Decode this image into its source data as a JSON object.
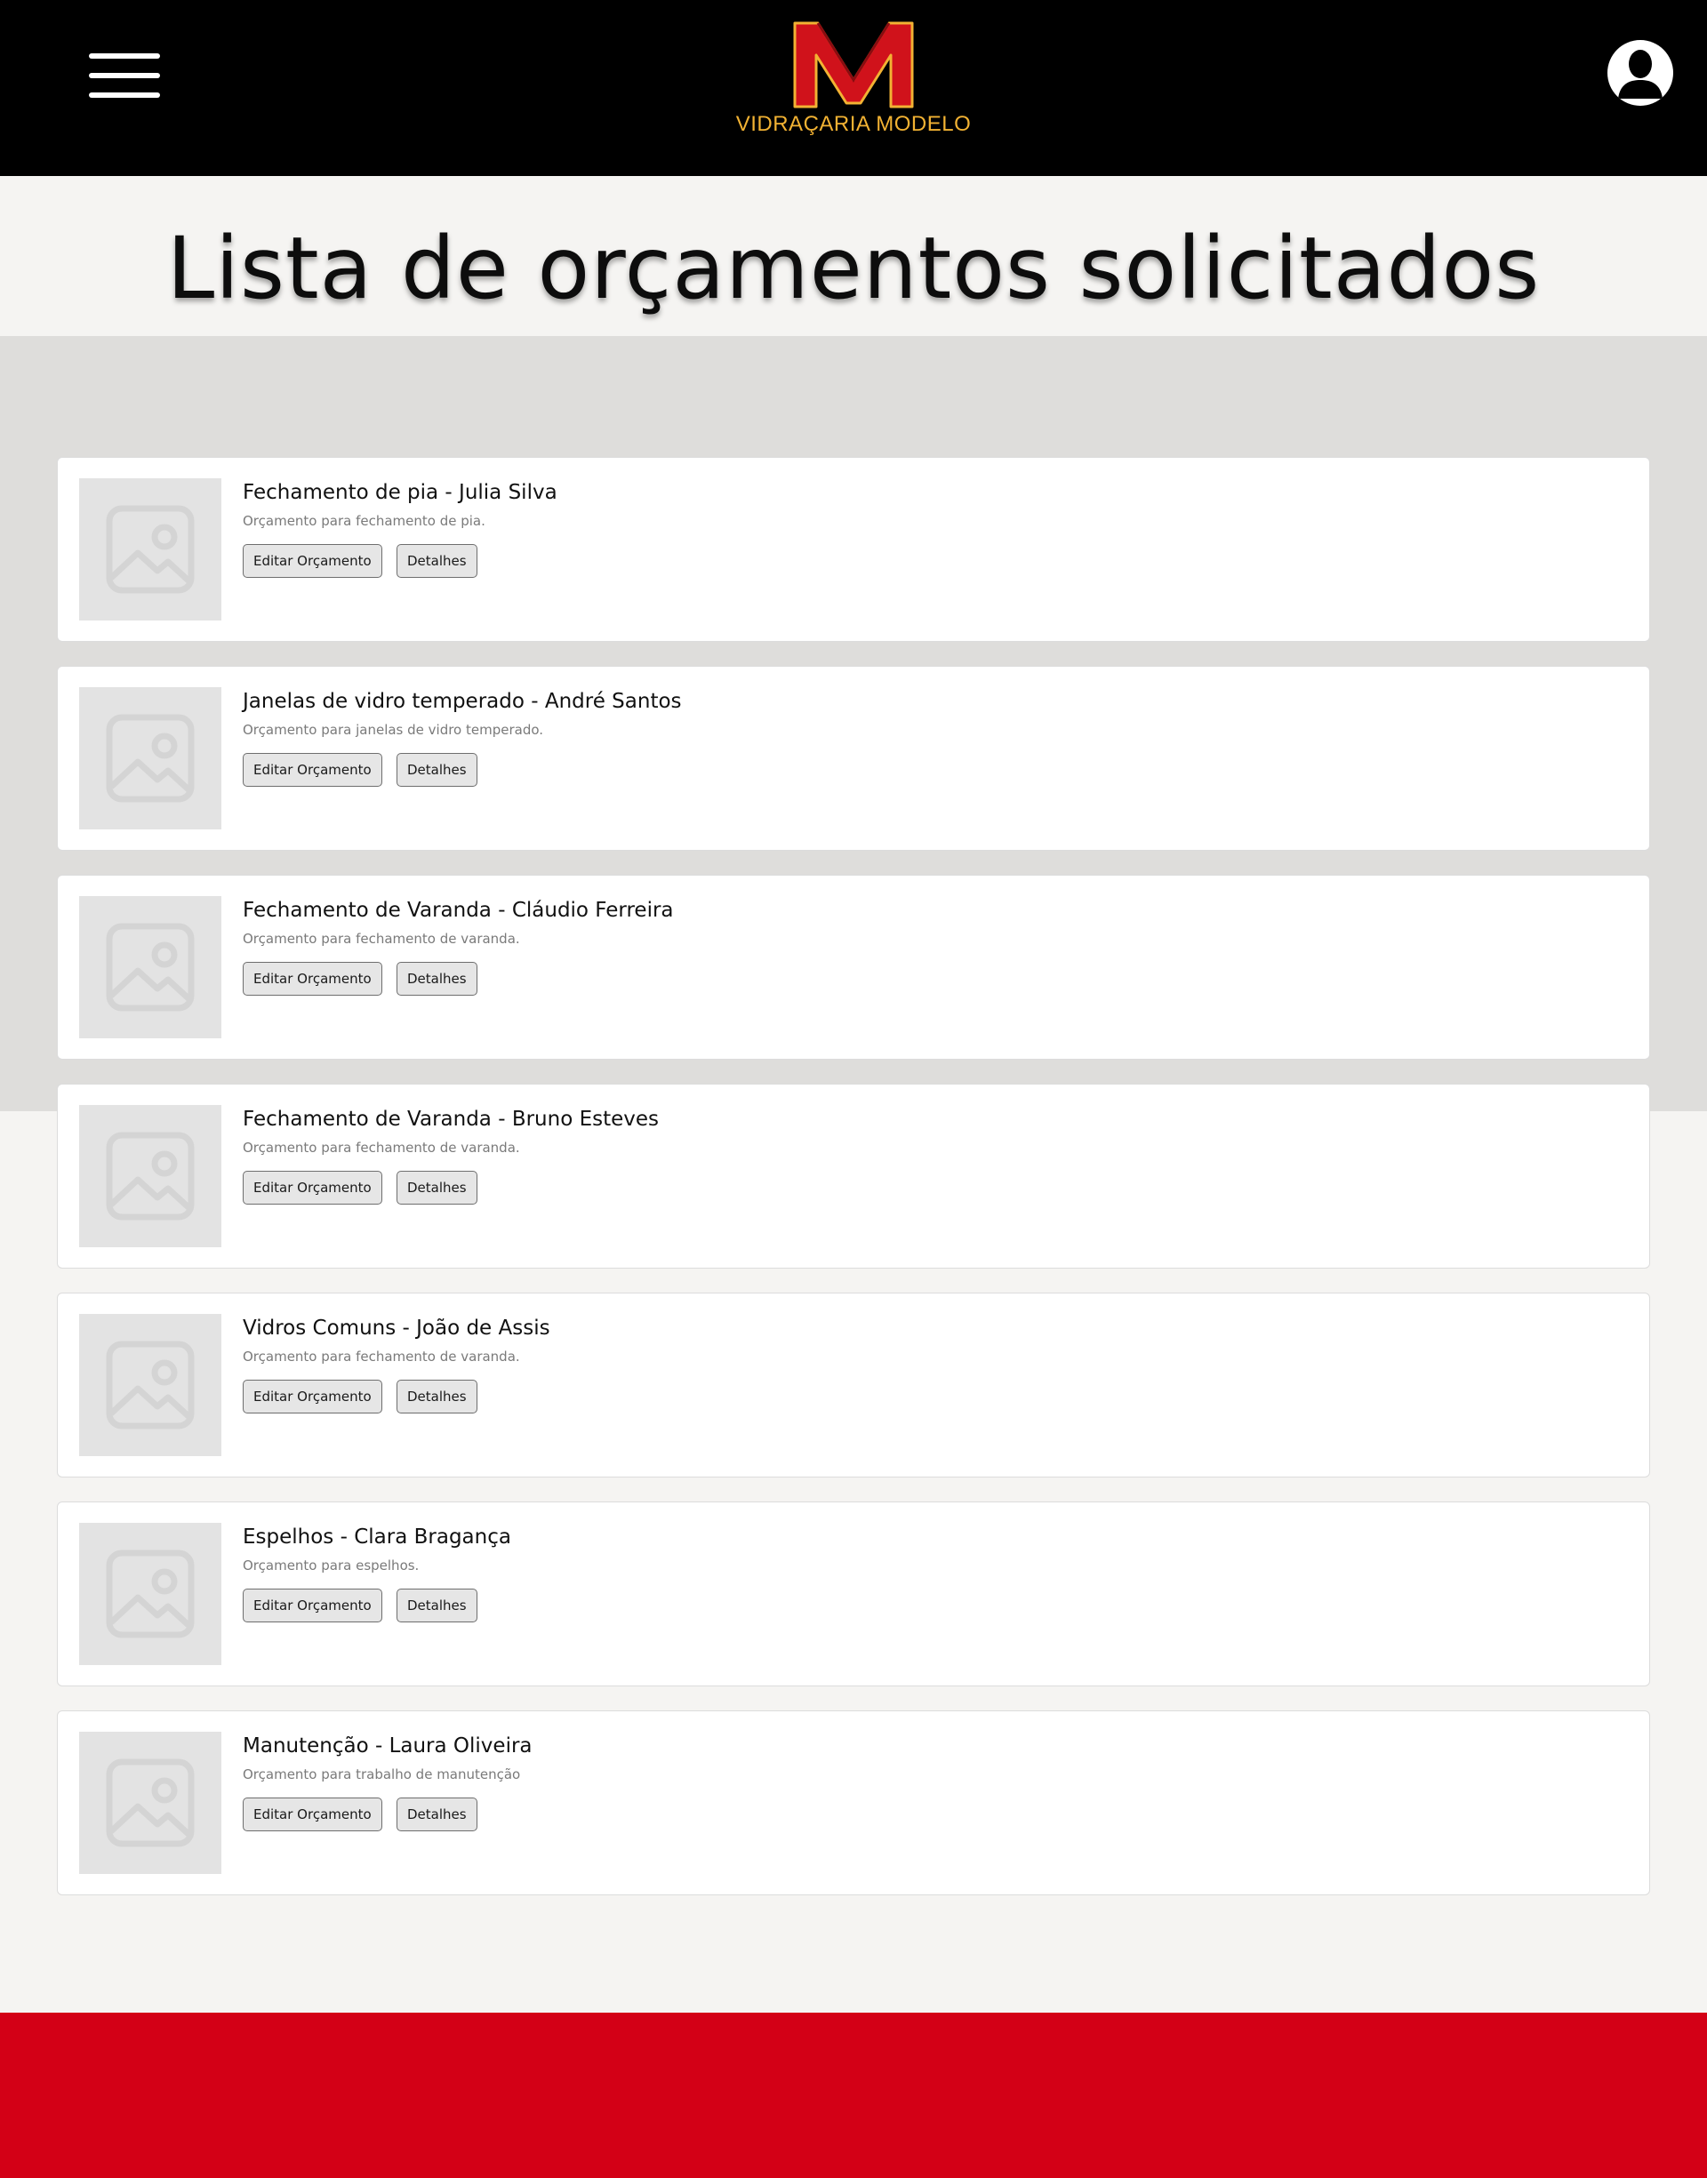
{
  "header": {
    "logo_text": "VIDRAÇARIA MODELO",
    "logo_icon": "m-monogram-logo",
    "menu_icon": "hamburger-menu-icon",
    "profile_icon": "user-avatar-icon"
  },
  "page": {
    "title": "Lista de orçamentos solicitados"
  },
  "quotes": [
    {
      "title": "Fechamento de pia - Julia Silva",
      "description": "Orçamento para fechamento de pia.",
      "edit_label": "Editar Orçamento",
      "details_label": "Detalhes"
    },
    {
      "title": "Janelas de vidro temperado - André Santos",
      "description": "Orçamento para janelas de vidro temperado.",
      "edit_label": "Editar Orçamento",
      "details_label": "Detalhes"
    },
    {
      "title": "Fechamento de Varanda - Cláudio Ferreira",
      "description": "Orçamento para fechamento de varanda.",
      "edit_label": "Editar Orçamento",
      "details_label": "Detalhes"
    },
    {
      "title": "Fechamento de Varanda - Bruno Esteves",
      "description": "Orçamento para fechamento de varanda.",
      "edit_label": "Editar Orçamento",
      "details_label": "Detalhes"
    },
    {
      "title": "Vidros Comuns - João de Assis",
      "description": "Orçamento para fechamento de varanda.",
      "edit_label": "Editar Orçamento",
      "details_label": "Detalhes"
    },
    {
      "title": "Espelhos - Clara Bragança",
      "description": "Orçamento para espelhos.",
      "edit_label": "Editar Orçamento",
      "details_label": "Detalhes"
    },
    {
      "title": "Manutenção - Laura Oliveira",
      "description": "Orçamento para trabalho de manutenção",
      "edit_label": "Editar Orçamento",
      "details_label": "Detalhes"
    }
  ],
  "colors": {
    "header_bg": "#000000",
    "logo_red": "#d0121b",
    "logo_gold": "#f2b233",
    "footer_red": "#d30016",
    "gray_band": "#dedddb",
    "page_bg": "#f5f4f2"
  },
  "thumbnail_icon": "image-placeholder-icon"
}
